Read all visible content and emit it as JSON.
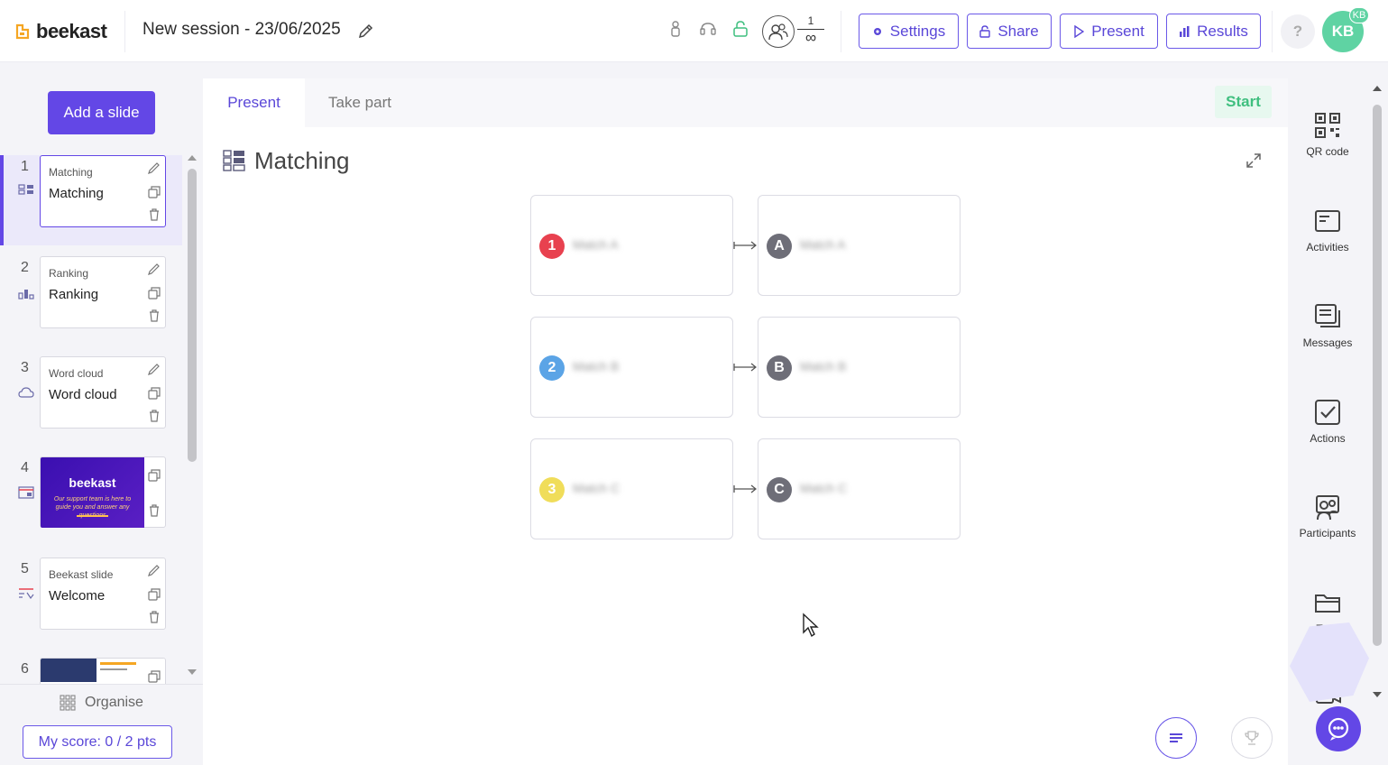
{
  "header": {
    "brand": "beekast",
    "session_title": "New session - 23/06/2025",
    "participants_count": "1",
    "participants_limit": "∞",
    "buttons": {
      "settings": "Settings",
      "share": "Share",
      "present": "Present",
      "results": "Results"
    },
    "help": "?",
    "avatar_initials": "KB",
    "avatar_badge": "KB"
  },
  "sidebar": {
    "add_slide": "Add a slide",
    "slides": [
      {
        "num": "1",
        "type": "Matching",
        "title": "Matching"
      },
      {
        "num": "2",
        "type": "Ranking",
        "title": "Ranking"
      },
      {
        "num": "3",
        "type": "Word cloud",
        "title": "Word cloud"
      },
      {
        "num": "4",
        "thumb_brand": "beekast",
        "thumb_text": "Our support team is here to guide you and answer any questions"
      },
      {
        "num": "5",
        "type": "Beekast slide",
        "title": "Welcome"
      },
      {
        "num": "6"
      }
    ],
    "organise": "Organise",
    "score": "My score: 0 / 2 pts"
  },
  "main": {
    "tabs": [
      {
        "label": "Present",
        "active": true
      },
      {
        "label": "Take part",
        "active": false
      }
    ],
    "start": "Start",
    "slide_title": "Matching",
    "pairs": [
      {
        "left_badge": "1",
        "left_color": "#e8414f",
        "left_text": "Match A",
        "right_badge": "A",
        "right_text": "Match A"
      },
      {
        "left_badge": "2",
        "left_color": "#5ba4e6",
        "left_text": "Match B",
        "right_badge": "B",
        "right_text": "Match B"
      },
      {
        "left_badge": "3",
        "left_color": "#f0dd5a",
        "left_text": "Match C",
        "right_badge": "C",
        "right_text": "Match C"
      }
    ],
    "right_badge_color": "#6e6e78"
  },
  "rail": {
    "items": [
      {
        "label": "QR code",
        "icon": "qr-code-icon"
      },
      {
        "label": "Activities",
        "icon": "activities-icon"
      },
      {
        "label": "Messages",
        "icon": "messages-icon"
      },
      {
        "label": "Actions",
        "icon": "actions-icon"
      },
      {
        "label": "Participants",
        "icon": "participants-icon"
      },
      {
        "label": "Tabs",
        "icon": "tabs-icon"
      }
    ]
  },
  "colors": {
    "accent": "#6347e6",
    "start_green": "#3fbf7f",
    "avatar": "#5fd3a3"
  }
}
